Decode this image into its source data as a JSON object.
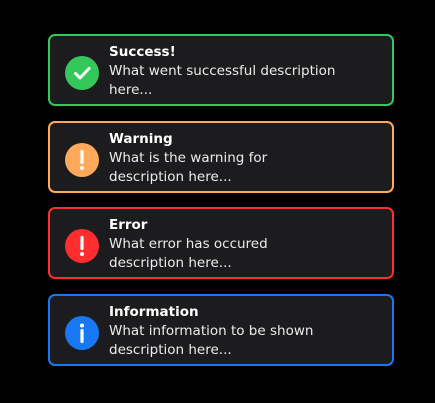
{
  "colors": {
    "background": "#000000",
    "card_background": "#1c1c1e",
    "success": "#34c759",
    "warning": "#ffa95a",
    "error": "#ff2d2d",
    "info": "#1878f3"
  },
  "alerts": [
    {
      "type": "success",
      "icon": "check-circle-icon",
      "title": "Success!",
      "description": "What went successful description here..."
    },
    {
      "type": "warning",
      "icon": "exclamation-circle-icon",
      "title": "Warning",
      "description": "What is the warning for description here..."
    },
    {
      "type": "error",
      "icon": "exclamation-circle-icon",
      "title": "Error",
      "description": "What error has occured description here..."
    },
    {
      "type": "info",
      "icon": "info-circle-icon",
      "title": "Information",
      "description": "What information to be shown description here..."
    }
  ]
}
